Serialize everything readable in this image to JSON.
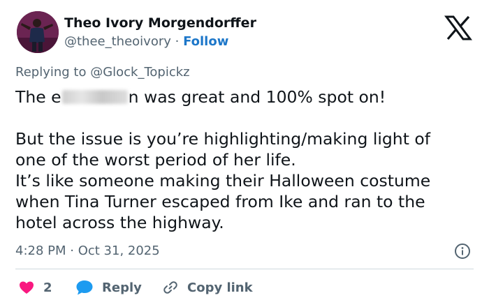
{
  "author": {
    "display_name": "Theo Ivory Morgendorffer",
    "handle": "@thee_theoivory",
    "separator": " · ",
    "follow_label": "Follow"
  },
  "reply_context": {
    "prefix": "Replying to ",
    "handle": "@Glock_Topickz"
  },
  "tweet": {
    "line1_start": "The e",
    "line1_end": "n was great and 100% spot on!",
    "line2": "But the issue is you’re highlighting/making light of",
    "line3": "one of the worst period of her life.",
    "line4": "It’s like someone making their Halloween costume",
    "line5": "when Tina Turner escaped from Ike and ran to the",
    "line6": "hotel across the highway."
  },
  "timestamp": "4:28 PM · Oct 31, 2025",
  "actions": {
    "like_count": "2",
    "reply_label": "Reply",
    "copy_label": "Copy link"
  },
  "icons": {
    "brand": "x-logo-icon",
    "like": "heart-icon",
    "reply": "speech-bubble-icon",
    "copy": "link-icon",
    "info": "info-icon"
  },
  "colors": {
    "text": "#0f1419",
    "secondary": "#536471",
    "follow": "#1d77c9",
    "like": "#f91880",
    "reply": "#1d9bf0",
    "divider": "#cfd9de"
  }
}
